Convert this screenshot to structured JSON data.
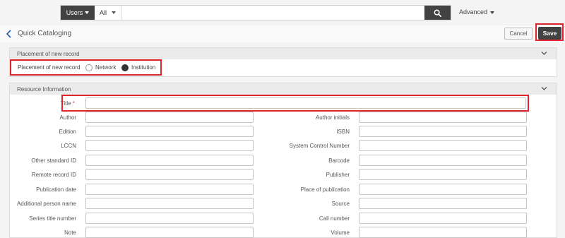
{
  "search": {
    "scope_label": "Users",
    "filter_label": "All",
    "input_value": "",
    "advanced_label": "Advanced"
  },
  "header": {
    "title": "Quick Cataloging",
    "cancel_label": "Cancel",
    "save_label": "Save"
  },
  "placement": {
    "section_title": "Placement of new record",
    "row_label": "Placement of new record",
    "options": [
      {
        "label": "Network",
        "selected": false
      },
      {
        "label": "Institution",
        "selected": true
      }
    ]
  },
  "resource": {
    "section_title": "Resource Information",
    "title_label": "Title",
    "required_marker": "*",
    "left_fields": [
      "Author",
      "Edition",
      "LCCN",
      "Other standard ID",
      "Remote record ID",
      "Publication date",
      "Additional person name",
      "Series title number",
      "Note"
    ],
    "right_fields": [
      "Author initials",
      "ISBN",
      "System Control Number",
      "Barcode",
      "Publisher",
      "Place of publication",
      "Source",
      "Call number",
      "Volume"
    ]
  },
  "colors": {
    "dark_button": "#424242",
    "highlight": "#e0242c",
    "accent_blue": "#1f5fa8"
  }
}
